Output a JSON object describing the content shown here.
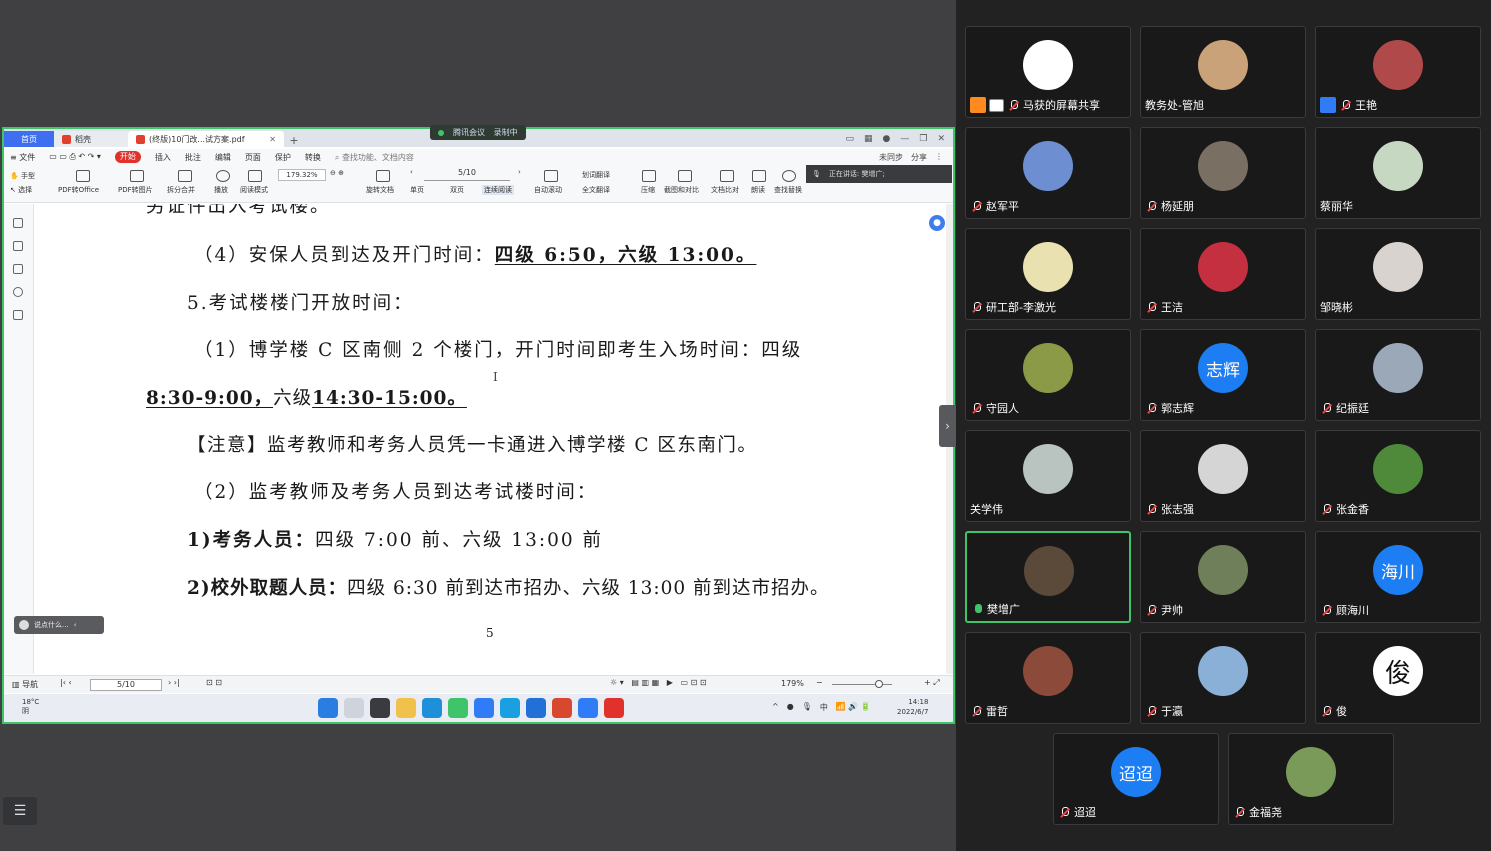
{
  "tabs": {
    "home": "首页",
    "store": "稻壳",
    "doc": "(终版)10门改...试方案.pdf"
  },
  "meeting_pill": {
    "label": "腾讯会议",
    "recording": "录制中"
  },
  "menu": {
    "file": "文件",
    "start": "开始",
    "items": [
      "插入",
      "批注",
      "编辑",
      "页面",
      "保护",
      "转换"
    ],
    "search": "查找功能、文档内容",
    "sync": "未同步",
    "share": "分享"
  },
  "toolbar": {
    "hand": "手型",
    "select": "选择",
    "pdf_office": "PDF转Office",
    "pdf_image": "PDF转图片",
    "split_merge": "拆分合并",
    "play": "播放",
    "read_mode": "阅读模式",
    "zoom": "179.32%",
    "page": "5/10",
    "rotate": "旋转文档",
    "single": "单页",
    "double": "双页",
    "continuous": "连续阅读",
    "auto_scroll": "自动滚动",
    "translate": "划词翻译",
    "full_translate": "全文翻译",
    "compress": "压缩",
    "screenshot_compare": "截图和对比",
    "doc_compare": "文档比对",
    "read_aloud": "朗读",
    "find_replace": "查找替换"
  },
  "speaking": "正在讲话: 樊增广;",
  "document": {
    "line0": "另证件出入考试楼。",
    "line1_prefix": "（4）安保人员到达及开门时间：",
    "line1_bold": "四级 6:50，六级 13:00。",
    "line2": "5.考试楼楼门开放时间：",
    "line3": "（1）博学楼 C 区南侧 2 个楼门，开门时间即考生入场时间：四级",
    "line4_a": "8:30-9:00，",
    "line4_b": "六级",
    "line4_c": "14:30-15:00。",
    "line5": "【注意】监考教师和考务人员凭一卡通进入博学楼 C 区东南门。",
    "line6": "（2）监考教师及考务人员到达考试楼时间：",
    "line7_bold": "1)考务人员：",
    "line7_rest": "四级 7:00 前、六级 13:00 前",
    "line8_bold": "2)校外取题人员：",
    "line8_rest": "四级 6:30 前到达市招办、六级 13:00 前到达市招办。",
    "page_number": "5"
  },
  "chat_placeholder": "说点什么...",
  "statusbar": {
    "nav": "导航",
    "page": "5/10",
    "zoom": "179%"
  },
  "taskbar": {
    "temp": "18°C",
    "weather": "阴",
    "ime": "中",
    "time": "14:18",
    "date": "2022/6/7"
  },
  "participants": [
    {
      "name": "马获的屏幕共享",
      "avatar_color": "#ffffff",
      "muted": true,
      "sharing": true
    },
    {
      "name": "教务处-管旭",
      "avatar_color": "#c9a27a",
      "muted": false
    },
    {
      "name": "王艳",
      "avatar_color": "#b04a4a",
      "muted": true,
      "host": true
    },
    {
      "name": "赵军平",
      "avatar_color": "#6d8fd1",
      "muted": true
    },
    {
      "name": "杨延朋",
      "avatar_color": "#7a6f63",
      "muted": true
    },
    {
      "name": "蔡丽华",
      "avatar_color": "#c7d8c2",
      "muted": false
    },
    {
      "name": "研工部-李激光",
      "avatar_color": "#e9e2b0",
      "muted": true
    },
    {
      "name": "王洁",
      "avatar_color": "#c53040",
      "muted": true
    },
    {
      "name": "邹晓彬",
      "avatar_color": "#d9d3cf",
      "muted": false
    },
    {
      "name": "守园人",
      "avatar_color": "#8a9a46",
      "muted": true
    },
    {
      "name": "郭志辉",
      "avatar_text": "志辉",
      "avatar_color": "#1c7ef2",
      "muted": true
    },
    {
      "name": "纪振廷",
      "avatar_color": "#9aa8b8",
      "muted": true
    },
    {
      "name": "关学伟",
      "avatar_color": "#b9c4c0",
      "muted": false
    },
    {
      "name": "张志强",
      "avatar_color": "#d5d5d5",
      "muted": true
    },
    {
      "name": "张金香",
      "avatar_color": "#4e8a3a",
      "muted": true
    },
    {
      "name": "樊增广",
      "avatar_color": "#5b4a3a",
      "muted": false,
      "speaking": true
    },
    {
      "name": "尹帅",
      "avatar_color": "#6f7f5a",
      "muted": true
    },
    {
      "name": "顾海川",
      "avatar_text": "海川",
      "avatar_color": "#1c7ef2",
      "muted": true
    },
    {
      "name": "雷哲",
      "avatar_color": "#8c4a3a",
      "muted": true
    },
    {
      "name": "于瀛",
      "avatar_color": "#8ab0d8",
      "muted": true
    },
    {
      "name": "俊",
      "avatar_text": "俊",
      "avatar_color": "#ffffff",
      "muted": true
    },
    {
      "name": "迢迢",
      "avatar_text": "迢迢",
      "avatar_color": "#1c7ef2",
      "muted": true
    },
    {
      "name": "金福尧",
      "avatar_color": "#7a9a5a",
      "muted": true
    }
  ]
}
